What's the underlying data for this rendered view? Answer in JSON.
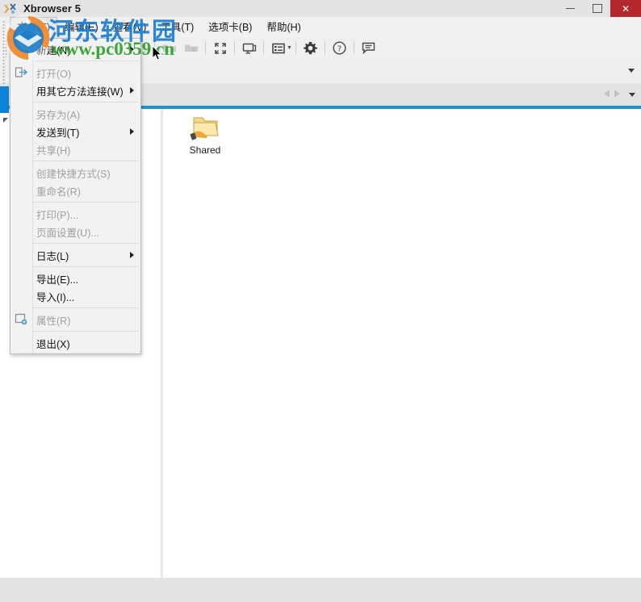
{
  "window": {
    "title": "Xbrowser 5",
    "app_icon": "xbrowser-logo-icon",
    "minimize_label": "—",
    "maximize_label": "□",
    "close_label": "✕"
  },
  "menubar": {
    "items": [
      {
        "label": "文件(F)",
        "name": "menu-file",
        "active": true
      },
      {
        "label": "编辑(E)",
        "name": "menu-edit",
        "active": false
      },
      {
        "label": "查看(V)",
        "name": "menu-view",
        "active": false
      },
      {
        "label": "工具(T)",
        "name": "menu-tools",
        "active": false
      },
      {
        "label": "选项卡(B)",
        "name": "menu-tabs",
        "active": false
      },
      {
        "label": "帮助(H)",
        "name": "menu-help",
        "active": false
      }
    ]
  },
  "toolbar": {
    "buttons": [
      {
        "name": "back-icon",
        "icon": "arrow-left",
        "enabled": false
      },
      {
        "name": "forward-icon",
        "icon": "arrow-right",
        "enabled": false
      },
      {
        "name": "up-folder-icon",
        "icon": "folder",
        "enabled": false
      },
      {
        "name": "cut-icon",
        "icon": "scissors",
        "enabled": false
      },
      {
        "name": "copy-icon",
        "icon": "copy",
        "enabled": false
      },
      {
        "name": "paste-icon",
        "icon": "paste",
        "enabled": false
      },
      {
        "name": "upload-icon",
        "icon": "folder-up",
        "enabled": false
      },
      {
        "name": "download-icon",
        "icon": "folder-down",
        "enabled": false
      },
      {
        "name": "fullscreen-icon",
        "icon": "expand",
        "enabled": true
      },
      {
        "name": "new-window-icon",
        "icon": "monitor",
        "enabled": true
      },
      {
        "name": "view-list-icon",
        "icon": "list",
        "enabled": true,
        "has_caret": true
      },
      {
        "name": "settings-gear-icon",
        "icon": "gear",
        "enabled": true
      },
      {
        "name": "help-icon",
        "icon": "question-circle",
        "enabled": true
      },
      {
        "name": "feedback-icon",
        "icon": "chat-bubble",
        "enabled": true
      }
    ]
  },
  "addressbar": {
    "value": "",
    "placeholder": "",
    "dropdown_icon": "chevron-down-icon"
  },
  "tabstrip": {
    "prev_icon": "triangle-left-icon",
    "next_icon": "triangle-right-icon",
    "overflow_icon": "chevron-down-icon"
  },
  "file_menu": {
    "title": "文件(F)",
    "items": [
      {
        "label": "新建(N)",
        "name": "menu-new",
        "enabled": true,
        "submenu": true,
        "separator_after": true,
        "icon": null
      },
      {
        "label": "打开(O)",
        "name": "menu-open",
        "enabled": false,
        "submenu": false,
        "separator_after": false,
        "icon": "open-folder-icon"
      },
      {
        "label": "用其它方法连接(W)",
        "name": "menu-connect-other",
        "enabled": true,
        "submenu": true,
        "separator_after": true,
        "icon": null
      },
      {
        "label": "另存为(A)",
        "name": "menu-save-as",
        "enabled": false,
        "submenu": false,
        "separator_after": false,
        "icon": null
      },
      {
        "label": "发送到(T)",
        "name": "menu-send-to",
        "enabled": true,
        "submenu": true,
        "separator_after": false,
        "icon": null
      },
      {
        "label": "共享(H)",
        "name": "menu-share",
        "enabled": false,
        "submenu": false,
        "separator_after": true,
        "icon": null
      },
      {
        "label": "创建快捷方式(S)",
        "name": "menu-create-shortcut",
        "enabled": false,
        "submenu": false,
        "separator_after": false,
        "icon": null
      },
      {
        "label": "重命名(R)",
        "name": "menu-rename",
        "enabled": false,
        "submenu": false,
        "separator_after": true,
        "icon": null
      },
      {
        "label": "打印(P)...",
        "name": "menu-print",
        "enabled": false,
        "submenu": false,
        "separator_after": false,
        "icon": null
      },
      {
        "label": "页面设置(U)...",
        "name": "menu-page-setup",
        "enabled": false,
        "submenu": false,
        "separator_after": true,
        "icon": null
      },
      {
        "label": "日志(L)",
        "name": "menu-log",
        "enabled": true,
        "submenu": true,
        "separator_after": true,
        "icon": null
      },
      {
        "label": "导出(E)...",
        "name": "menu-export",
        "enabled": true,
        "submenu": false,
        "separator_after": false,
        "icon": null
      },
      {
        "label": "导入(I)...",
        "name": "menu-import",
        "enabled": true,
        "submenu": false,
        "separator_after": true,
        "icon": null
      },
      {
        "label": "属性(R)",
        "name": "menu-properties",
        "enabled": false,
        "submenu": false,
        "separator_after": true,
        "icon": "properties-icon"
      },
      {
        "label": "退出(X)",
        "name": "menu-exit",
        "enabled": true,
        "submenu": false,
        "separator_after": false,
        "icon": null
      }
    ]
  },
  "content": {
    "items": [
      {
        "label": "Shared",
        "name": "shared-folder-item",
        "icon": "shared-folder-icon"
      }
    ]
  },
  "watermark": {
    "site_name": "河东软件园",
    "site_url": "www.pc0359.cn",
    "logo": "watermark-logo-icon"
  },
  "colors": {
    "accent_blue": "#0a84d8",
    "tab_line_blue": "#1e90d8",
    "close_red": "#b3282d",
    "chrome_gray": "#f0f0f0",
    "watermark_blue": "#1a7fd4",
    "watermark_green": "#2aa22a"
  }
}
